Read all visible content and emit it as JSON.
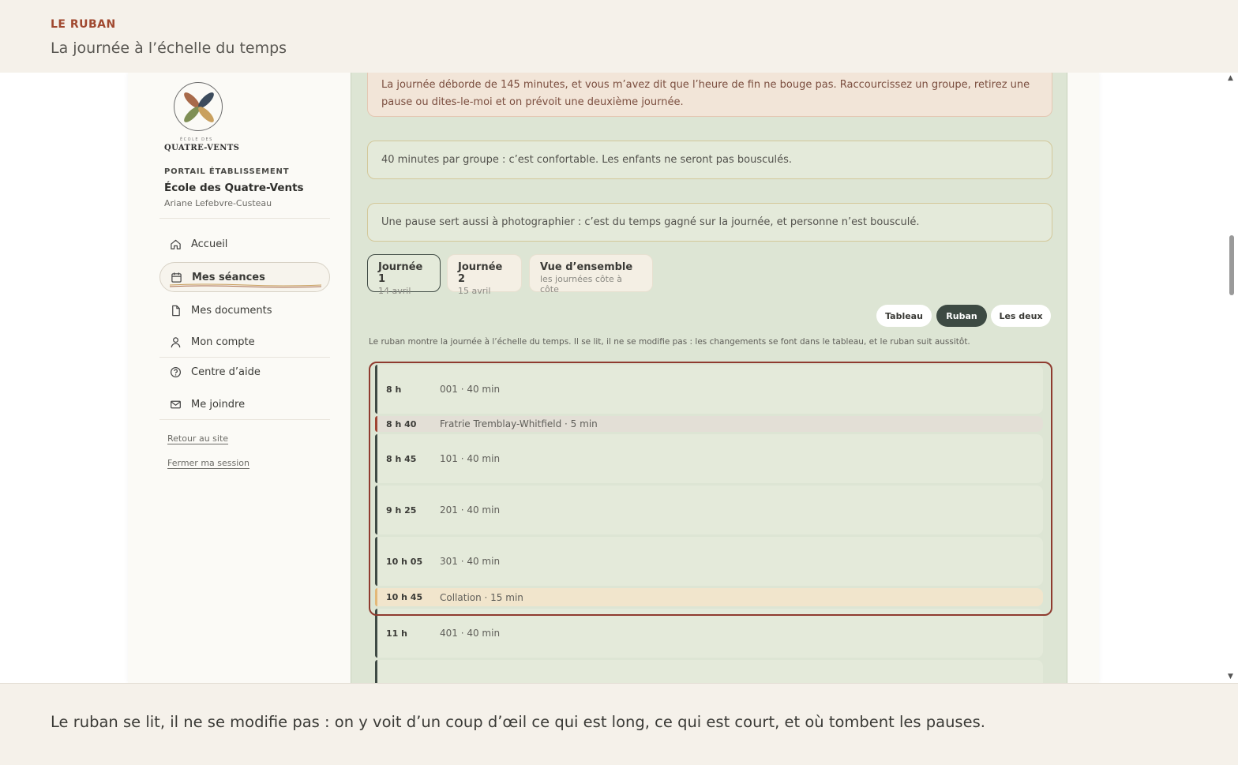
{
  "header": {
    "kicker": "LE RUBAN",
    "title": "La journée à l’échelle du temps"
  },
  "sidebar": {
    "logo_small": "ÉCOLE DES",
    "logo_name": "QUATRE-VENTS",
    "portal_label": "PORTAIL ÉTABLISSEMENT",
    "school_name": "École des Quatre-Vents",
    "user_name": "Ariane Lefebvre-Custeau",
    "nav": [
      {
        "label": "Accueil",
        "icon": "home-icon"
      },
      {
        "label": "Mes séances",
        "icon": "calendar-icon",
        "active": true
      },
      {
        "label": "Mes documents",
        "icon": "document-icon"
      },
      {
        "label": "Mon compte",
        "icon": "user-icon"
      },
      {
        "label": "Centre d’aide",
        "icon": "help-icon"
      },
      {
        "label": "Me joindre",
        "icon": "mail-icon"
      }
    ],
    "links": [
      "Retour au site",
      "Fermer ma session"
    ]
  },
  "notices": [
    "La journée déborde de 145 minutes, et vous m’avez dit que l’heure de fin ne bouge pas. Raccourcissez un groupe, retirez une pause ou dites-le-moi et on prévoit une deuxième journée.",
    "40 minutes par groupe : c’est confortable. Les enfants ne seront pas bousculés.",
    "Une pause sert aussi à photographier : c’est du temps gagné sur la journée, et personne n’est bousculé."
  ],
  "day_tabs": [
    {
      "title": "Journée 1",
      "sub": "14 avril",
      "active": true
    },
    {
      "title": "Journée 2",
      "sub": "15 avril"
    },
    {
      "title": "Vue d’ensemble",
      "sub": "les journées côte à côte"
    }
  ],
  "view_toggle": {
    "options": [
      "Tableau",
      "Ruban",
      "Les deux"
    ],
    "selected": "Ruban"
  },
  "ribbon_hint": "Le ruban montre la journée à l’échelle du temps. Il se lit, il ne se modifie pas : les changements se font dans le tableau, et le ruban suit aussitôt.",
  "ribbon": [
    {
      "time": "8 h",
      "label": "001 · 40 min",
      "kind": "group",
      "minutes": 40
    },
    {
      "time": "8 h 40",
      "label": "Fratrie Tremblay-Whitfield · 5 min",
      "kind": "sibling",
      "minutes": 5
    },
    {
      "time": "8 h 45",
      "label": "101 · 40 min",
      "kind": "group",
      "minutes": 40
    },
    {
      "time": "9 h 25",
      "label": "201 · 40 min",
      "kind": "group",
      "minutes": 40
    },
    {
      "time": "10 h 05",
      "label": "301 · 40 min",
      "kind": "group",
      "minutes": 40
    },
    {
      "time": "10 h 45",
      "label": "Collation · 15 min",
      "kind": "snack",
      "minutes": 15
    },
    {
      "time": "11 h",
      "label": "401 · 40 min",
      "kind": "group",
      "minutes": 40
    },
    {
      "time": "",
      "label": "",
      "kind": "group",
      "minutes": 40
    }
  ],
  "caption": "Le ruban se lit, il ne se modifie pas : on y voit d’un coup d’œil ce qui est long, ce qui est court, et où tombent les pauses.",
  "colors": {
    "accent": "#a0482f",
    "panel": "#dde5d4",
    "active_toggle": "#3d4a43",
    "focus": "#8f3b2f"
  }
}
